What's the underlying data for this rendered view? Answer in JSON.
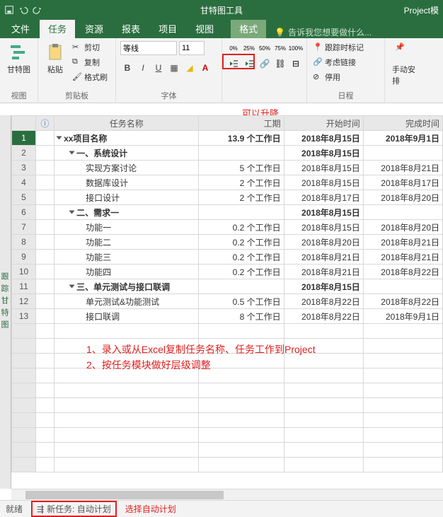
{
  "titlebar": {
    "center": "甘特图工具",
    "right": "Project模"
  },
  "tabs": {
    "file": "文件",
    "task": "任务",
    "resource": "资源",
    "report": "报表",
    "project": "项目",
    "view": "视图",
    "format": "格式",
    "tell": "告诉我您想要做什么..."
  },
  "ribbon": {
    "view_group": "视图",
    "gantt": "甘特图",
    "clipboard_group": "剪贴板",
    "paste": "粘贴",
    "cut": "剪切",
    "copy": "复制",
    "brush": "格式刷",
    "font_group": "字体",
    "font_name": "等线",
    "font_size": "11",
    "schedule_group": "日程",
    "track": "跟踪时标记",
    "links": "考虑链接",
    "deactivate": "停用",
    "manual": "手动安排"
  },
  "annotations": {
    "indent": "可以升降\n任务层级",
    "line1": "1、录入或从Excel复制任务名称、任务工作到Project",
    "line2": "2、按任务模块做好层级调整",
    "auto": "选择自动计划"
  },
  "columns": {
    "info": "❶",
    "name": "任务名称",
    "duration": "工期",
    "start": "开始时间",
    "finish": "完成时间"
  },
  "rows": [
    {
      "n": 1,
      "lvl": 0,
      "name": "xx项目名称",
      "dur": "13.9 个工作日",
      "start": "2018年8月15日",
      "end": "2018年9月1日",
      "bold": true
    },
    {
      "n": 2,
      "lvl": 1,
      "name": "一、系统设计",
      "dur": "",
      "start": "2018年8月15日",
      "end": "",
      "bold": true
    },
    {
      "n": 3,
      "lvl": 2,
      "name": "实现方案讨论",
      "dur": "5 个工作日",
      "start": "2018年8月15日",
      "end": "2018年8月21日"
    },
    {
      "n": 4,
      "lvl": 2,
      "name": "数据库设计",
      "dur": "2 个工作日",
      "start": "2018年8月15日",
      "end": "2018年8月17日"
    },
    {
      "n": 5,
      "lvl": 2,
      "name": "接口设计",
      "dur": "2 个工作日",
      "start": "2018年8月17日",
      "end": "2018年8月20日"
    },
    {
      "n": 6,
      "lvl": 1,
      "name": "二、需求一",
      "dur": "",
      "start": "2018年8月15日",
      "end": "",
      "bold": true
    },
    {
      "n": 7,
      "lvl": 2,
      "name": "功能一",
      "dur": "0.2 个工作日",
      "start": "2018年8月15日",
      "end": "2018年8月20日"
    },
    {
      "n": 8,
      "lvl": 2,
      "name": "功能二",
      "dur": "0.2 个工作日",
      "start": "2018年8月20日",
      "end": "2018年8月21日"
    },
    {
      "n": 9,
      "lvl": 2,
      "name": "功能三",
      "dur": "0.2 个工作日",
      "start": "2018年8月21日",
      "end": "2018年8月21日"
    },
    {
      "n": 10,
      "lvl": 2,
      "name": "功能四",
      "dur": "0.2 个工作日",
      "start": "2018年8月21日",
      "end": "2018年8月22日"
    },
    {
      "n": 11,
      "lvl": 1,
      "name": "三、单元测试与接口联调",
      "dur": "",
      "start": "2018年8月15日",
      "end": "",
      "bold": true
    },
    {
      "n": 12,
      "lvl": 2,
      "name": "单元测试&功能测试",
      "dur": "0.5 个工作日",
      "start": "2018年8月22日",
      "end": "2018年8月22日"
    },
    {
      "n": 13,
      "lvl": 2,
      "name": "接口联调",
      "dur": "8 个工作日",
      "start": "2018年8月22日",
      "end": "2018年9月1日"
    }
  ],
  "statusbar": {
    "ready": "就绪",
    "newtask": "新任务: 自动计划"
  },
  "sidebar_label": "跟踪甘特图"
}
